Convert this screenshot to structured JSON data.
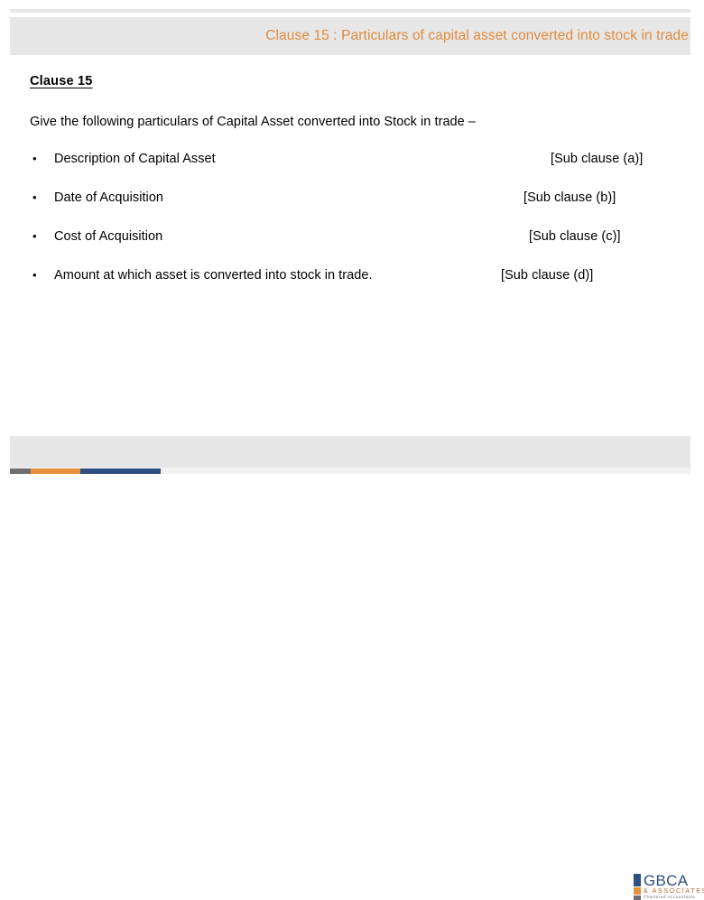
{
  "header": {
    "title": "Clause 15  : Particulars of capital asset converted into stock in trade",
    "accent_color": "#e08b3e",
    "band_color": "#e7e7e7"
  },
  "content": {
    "clause_heading": "Clause 15",
    "intro": "Give the following particulars of Capital Asset converted into Stock in trade –",
    "bullet_marker": "•",
    "items": [
      {
        "text": "Description  of  Capital  Asset",
        "ref": "[Sub  clause  (a)]"
      },
      {
        "text": "Date  of Acquisition",
        "ref": "[Sub clause (b)]"
      },
      {
        "text": "Cost of Acquisition",
        "ref": "[Sub clause (c)]"
      },
      {
        "text": "Amount at which asset is converted into stock in trade.",
        "ref": "[Sub clause (d)]"
      }
    ]
  },
  "footer": {
    "logo": {
      "name": "GBCA",
      "subtitle": "& ASSOCIATES",
      "tagline": "Chartered Accountants",
      "color_primary": "#2e4f82",
      "color_accent": "#e8903b",
      "color_neutral": "#6d6e71"
    },
    "strip": {
      "segment_gray": "#6d6e71",
      "segment_orange": "#e8903b",
      "segment_blue": "#2e4f82"
    }
  }
}
